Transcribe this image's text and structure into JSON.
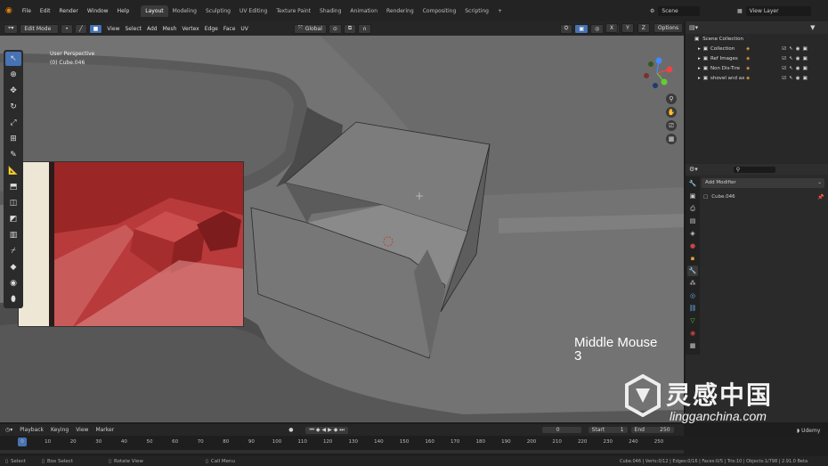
{
  "topbar": {
    "menu": [
      "File",
      "Edit",
      "Render",
      "Window",
      "Help"
    ],
    "workspaces": [
      "Layout",
      "Modeling",
      "Sculpting",
      "UV Editing",
      "Texture Paint",
      "Shading",
      "Animation",
      "Rendering",
      "Compositing",
      "Scripting"
    ],
    "active_workspace": "Layout",
    "add_workspace": "+",
    "scene_label": "Scene",
    "view_layer_label": "View Layer"
  },
  "viewport_header": {
    "mode": "Edit Mode",
    "menus": [
      "View",
      "Select",
      "Add",
      "Mesh",
      "Vertex",
      "Edge",
      "Face",
      "UV"
    ],
    "orientation": "Global",
    "options": "Options",
    "axes": [
      "X",
      "Y",
      "Z"
    ]
  },
  "viewport": {
    "perspective": "User Perspective",
    "object": "(0) Cube.046",
    "hint_line1": "Middle Mouse",
    "hint_line2": "3",
    "gizmo": {
      "x": "X",
      "y": "Y",
      "z": "Z"
    }
  },
  "outliner": {
    "root": "Scene Collection",
    "items": [
      "Collection",
      "Ref Images",
      "Non Dis-Tire",
      "shovel and ax"
    ]
  },
  "properties": {
    "add_modifier": "Add Modifier",
    "object": "Cube.046"
  },
  "timeline": {
    "menus": [
      "Playback",
      "Keying",
      "View",
      "Marker"
    ],
    "current_frame": "0",
    "start_label": "Start",
    "start_value": "1",
    "end_label": "End",
    "end_value": "250",
    "ticks": [
      "0",
      "10",
      "20",
      "30",
      "40",
      "50",
      "60",
      "70",
      "80",
      "90",
      "100",
      "110",
      "120",
      "130",
      "140",
      "150",
      "160",
      "170",
      "180",
      "190",
      "200",
      "210",
      "220",
      "230",
      "240",
      "250"
    ]
  },
  "statusbar": {
    "select": "Select",
    "box_select": "Box Select",
    "rotate_view": "Rotate View",
    "call_menu": "Call Menu",
    "stats": "Cube.046 | Verts:0/12 | Edges:0/16 | Faces:0/5 | Tris:10 | Objects:1/798 | 2.91.0 Beta"
  },
  "watermark": {
    "cjk": "灵感中国",
    "url": "lingganchina.com",
    "udemy": "Udemy"
  },
  "colors": {
    "accent": "#4772b3",
    "viewport_bg": "#6a6a6a",
    "reference_red": "#b83a3a"
  }
}
